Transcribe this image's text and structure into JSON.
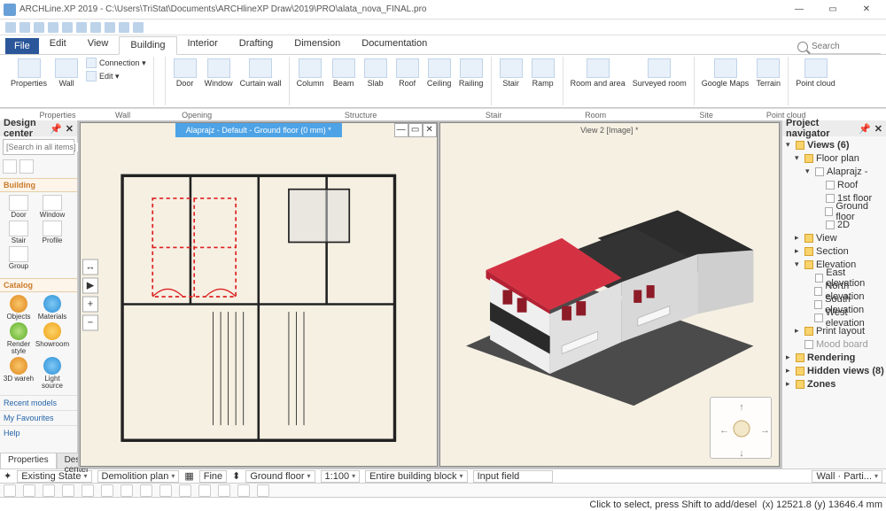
{
  "app": {
    "title": "ARCHLine.XP 2019 - C:\\Users\\TriStat\\Documents\\ARCHlineXP Draw\\2019\\PRO\\alata_nova_FINAL.pro",
    "search_placeholder": "Search"
  },
  "tabs": {
    "file": "File",
    "items": [
      "Edit",
      "View",
      "Building",
      "Interior",
      "Drafting",
      "Dimension",
      "Documentation"
    ],
    "active": "Building"
  },
  "ribbon": {
    "groups": [
      {
        "label": "Properties",
        "buttons": [
          {
            "l": "Properties"
          },
          {
            "l": "Wall"
          }
        ],
        "stack": [
          {
            "l": "Connection"
          },
          {
            "l": "Edit"
          }
        ]
      },
      {
        "label": "Wall",
        "buttons": []
      },
      {
        "label": "Opening",
        "buttons": [
          {
            "l": "Door"
          },
          {
            "l": "Window"
          },
          {
            "l": "Curtain wall"
          }
        ]
      },
      {
        "label": "Structure",
        "buttons": [
          {
            "l": "Column"
          },
          {
            "l": "Beam"
          },
          {
            "l": "Slab"
          },
          {
            "l": "Roof"
          },
          {
            "l": "Ceiling"
          },
          {
            "l": "Railing"
          }
        ]
      },
      {
        "label": "Stair",
        "buttons": [
          {
            "l": "Stair"
          },
          {
            "l": "Ramp"
          }
        ]
      },
      {
        "label": "Room",
        "buttons": [
          {
            "l": "Room and area"
          },
          {
            "l": "Surveyed room"
          }
        ]
      },
      {
        "label": "Site",
        "buttons": [
          {
            "l": "Google Maps"
          },
          {
            "l": "Terrain"
          }
        ]
      },
      {
        "label": "Point cloud",
        "buttons": [
          {
            "l": "Point cloud"
          }
        ]
      }
    ],
    "row_labels": [
      "Properties",
      "Wall",
      "Opening",
      "Structure",
      "Stair",
      "Room",
      "Site",
      "Point cloud"
    ]
  },
  "design_center": {
    "title": "Design center",
    "search_placeholder": "[Search in all items]",
    "sections": {
      "building": {
        "title": "Building",
        "items": [
          "Door",
          "Window",
          "Stair",
          "Profile",
          "Group"
        ]
      },
      "catalog": {
        "title": "Catalog",
        "items": [
          "Objects",
          "Materials",
          "Render style",
          "Showroom",
          "3D wareh",
          "Light source"
        ]
      },
      "recent": "Recent models",
      "fav": "My Favourites",
      "help": "Help"
    }
  },
  "views": {
    "v1": "Alaprajz - Default - Ground floor (0 mm) *",
    "v2": "View 2 [Image] *"
  },
  "navigator": {
    "title": "Project navigator",
    "nodes": [
      {
        "t": "Views (6)",
        "lv": 0,
        "exp": "▾",
        "b": 1,
        "ico": "f"
      },
      {
        "t": "Floor plan",
        "lv": 1,
        "exp": "▾",
        "ico": "f"
      },
      {
        "t": "Alaprajz -",
        "lv": 2,
        "exp": "▾",
        "ico": "p"
      },
      {
        "t": "Roof",
        "lv": 3,
        "ico": "p"
      },
      {
        "t": "1st floor",
        "lv": 3,
        "ico": "p"
      },
      {
        "t": "Ground floor",
        "lv": 3,
        "ico": "p"
      },
      {
        "t": "2D",
        "lv": 3,
        "ico": "p"
      },
      {
        "t": "View",
        "lv": 1,
        "exp": "▸",
        "ico": "f"
      },
      {
        "t": "Section",
        "lv": 1,
        "exp": "▸",
        "ico": "f"
      },
      {
        "t": "Elevation",
        "lv": 1,
        "exp": "▾",
        "ico": "f"
      },
      {
        "t": "East elevation",
        "lv": 2,
        "ico": "p"
      },
      {
        "t": "North elevation",
        "lv": 2,
        "ico": "p"
      },
      {
        "t": "South elevation",
        "lv": 2,
        "ico": "p"
      },
      {
        "t": "West elevation",
        "lv": 2,
        "ico": "p"
      },
      {
        "t": "Print layout",
        "lv": 1,
        "exp": "▸",
        "ico": "f"
      },
      {
        "t": "Mood board",
        "lv": 1,
        "ico": "p",
        "dim": 1
      },
      {
        "t": "Rendering",
        "lv": 0,
        "exp": "▸",
        "b": 1,
        "ico": "f"
      },
      {
        "t": "Hidden views (8)",
        "lv": 0,
        "exp": "▸",
        "b": 1,
        "ico": "f"
      },
      {
        "t": "Zones",
        "lv": 0,
        "exp": "▸",
        "b": 1,
        "ico": "f"
      }
    ]
  },
  "bottom_tabs": [
    "Properties",
    "Design center"
  ],
  "status": {
    "state": "Existing State",
    "plan": "Demolition plan",
    "fine": "Fine",
    "floor": "Ground floor",
    "scale": "1:100",
    "block": "Entire building block",
    "input": "Input field",
    "wall": "Wall · Parti..."
  },
  "footer": {
    "hint": "Click to select, press Shift to add/desel",
    "coords": "(x) 12521.8   (y) 13646.4 mm"
  }
}
